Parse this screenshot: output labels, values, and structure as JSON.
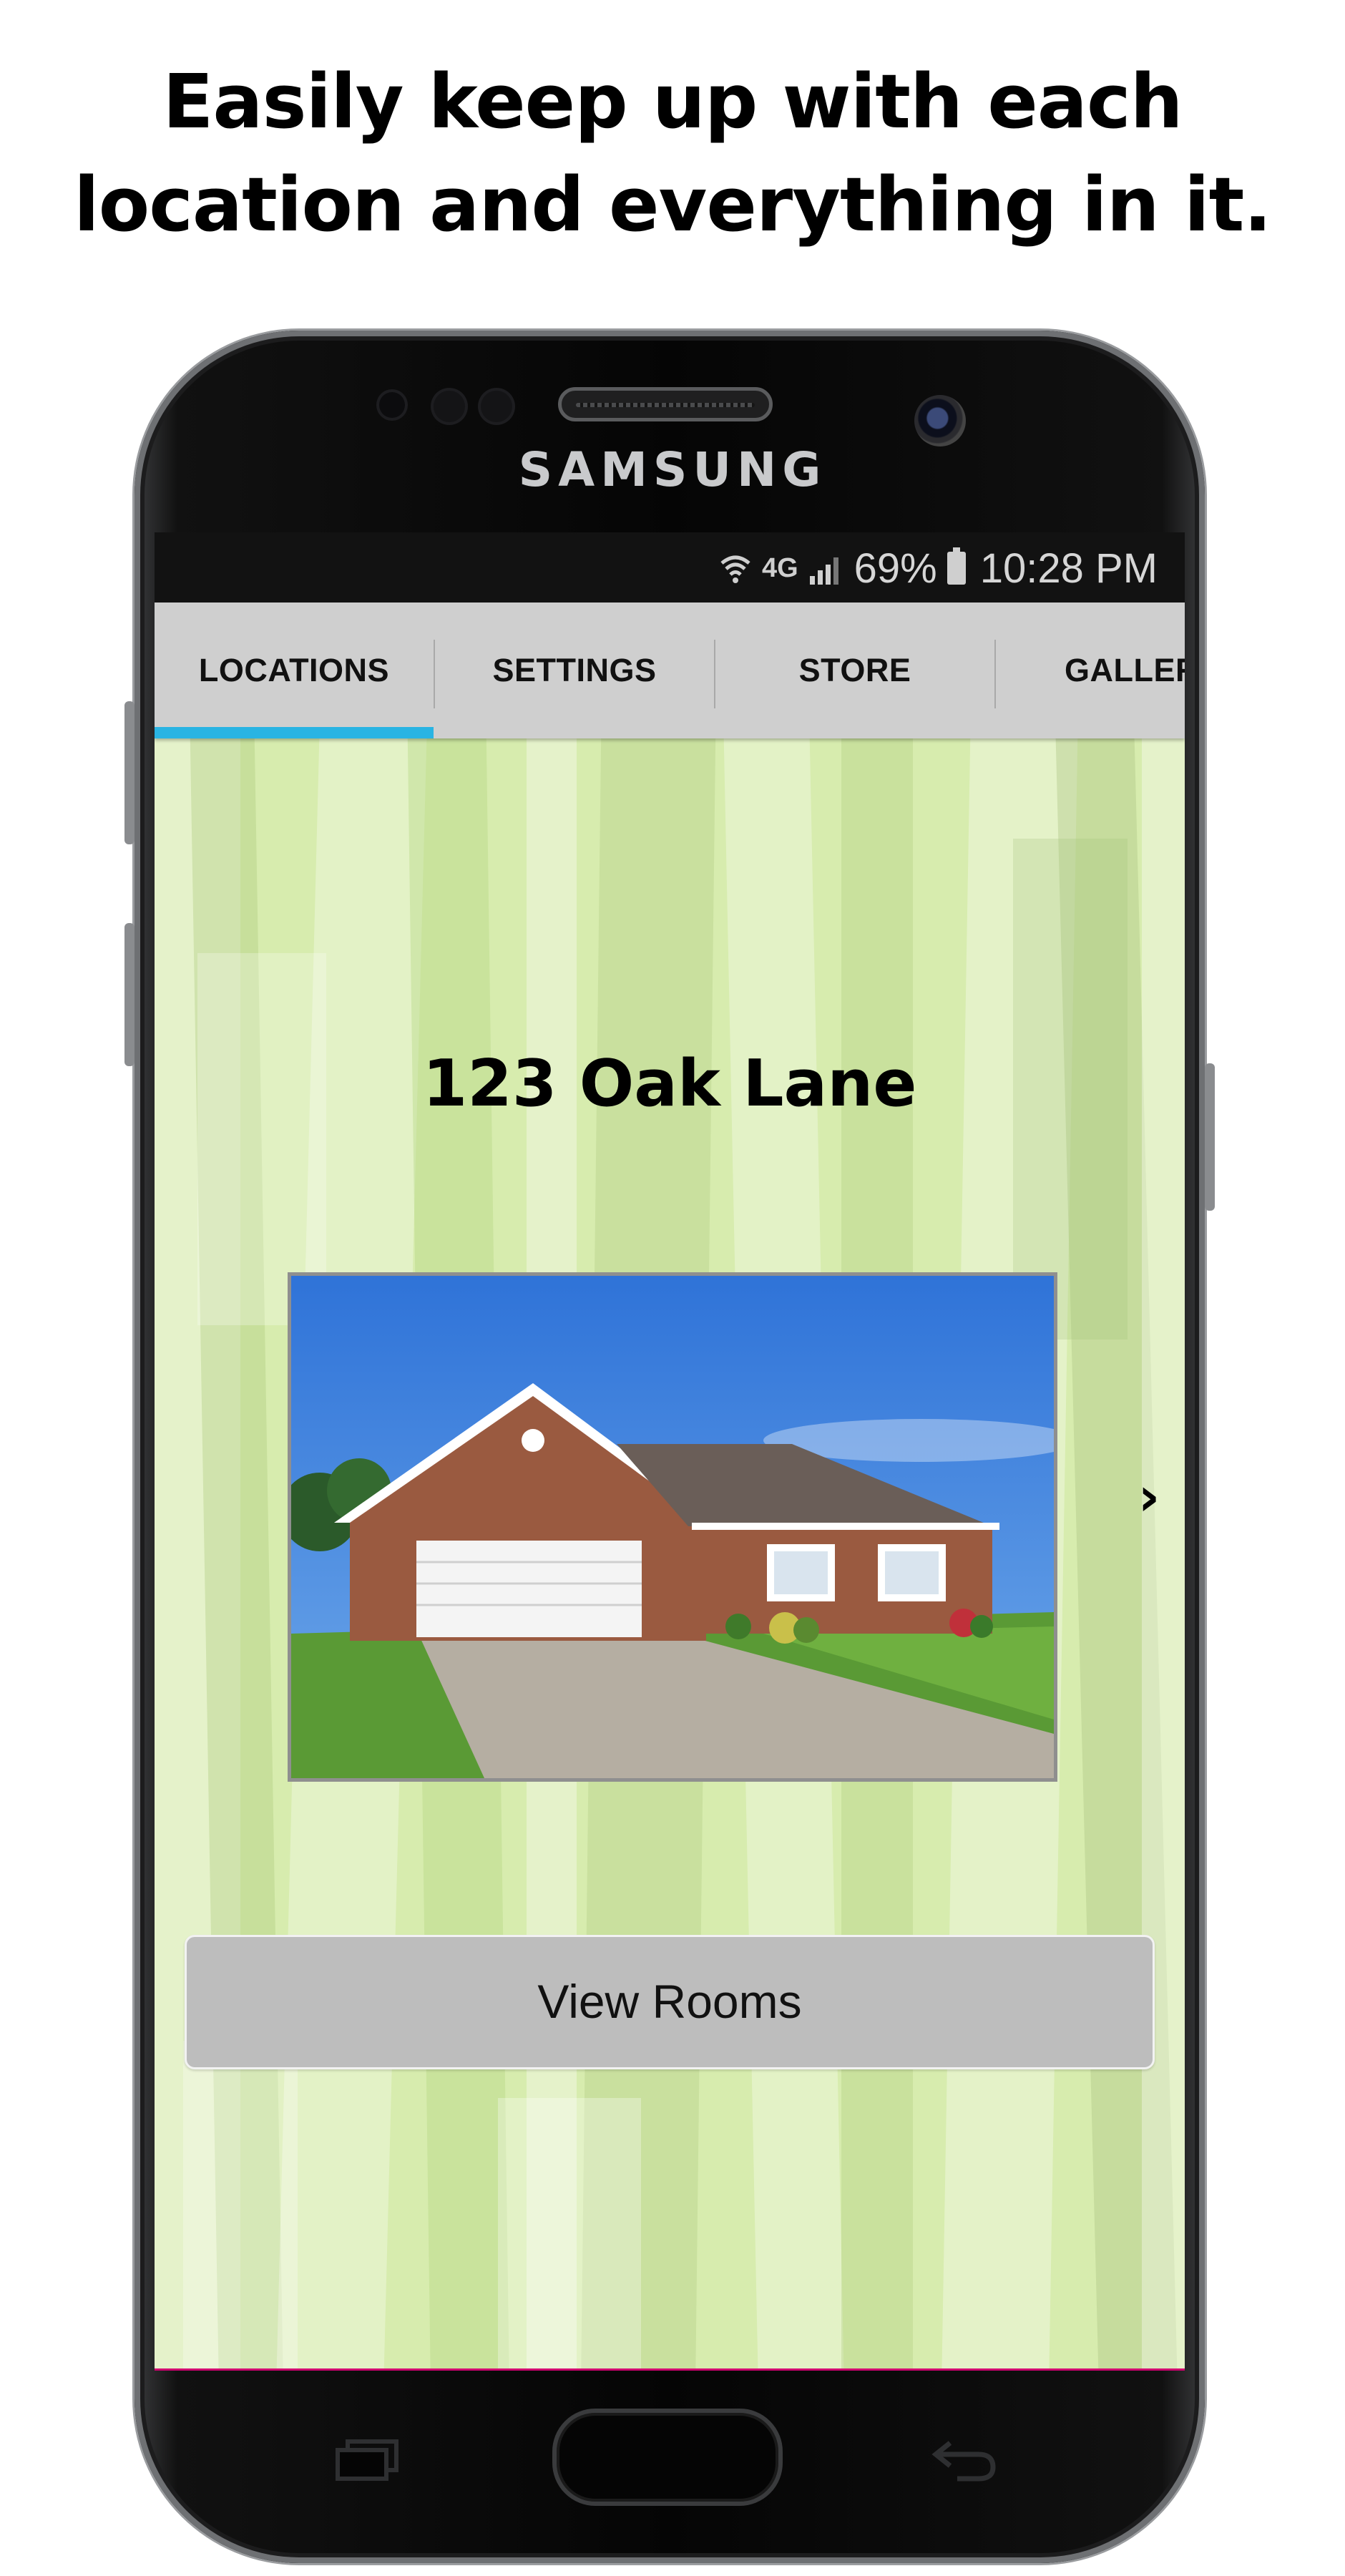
{
  "headline": {
    "line1": "Easily keep up with each",
    "line2": "location and everything in it."
  },
  "device": {
    "brand": "SAMSUNG"
  },
  "statusbar": {
    "network": "4G",
    "battery": "69%",
    "time": "10:28 PM"
  },
  "tabs": [
    {
      "label": "LOCATIONS",
      "active": true
    },
    {
      "label": "SETTINGS",
      "active": false
    },
    {
      "label": "STORE",
      "active": false
    },
    {
      "label": "GALLERY",
      "active": false
    }
  ],
  "location": {
    "title": "123 Oak Lane",
    "photo_icon": "house-photo",
    "next_icon": "chevron-right-icon",
    "next_glyph": "›"
  },
  "actions": {
    "view_rooms": "View Rooms"
  },
  "colors": {
    "tab_indicator": "#29b4e3",
    "background": "#d7ecae",
    "button": "#bdbdbd"
  }
}
